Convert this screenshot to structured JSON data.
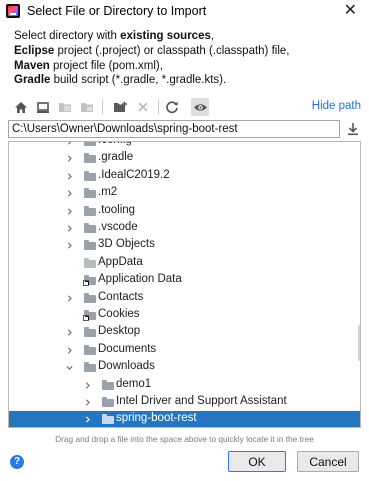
{
  "window": {
    "title": "Select File or Directory to Import",
    "close_symbol": "✕"
  },
  "description": {
    "line1_prefix": "Select directory with ",
    "line1_bold": "existing sources",
    "line1_suffix": ",",
    "line2_bold": "Eclipse",
    "line2_rest": " project (.project) or classpath (.classpath) file,",
    "line3_bold": "Maven",
    "line3_rest": " project file (pom.xml),",
    "line4_bold": "Gradle",
    "line4_rest": " build script (*.gradle, *.gradle.kts)."
  },
  "toolbar": {
    "buttons": [
      "home-icon",
      "desktop-icon",
      "project-folder-icon",
      "module-folder-icon",
      "new-folder-icon",
      "delete-icon",
      "refresh-icon",
      "show-hidden-icon"
    ],
    "hide_path_label": "Hide path"
  },
  "path": {
    "value": "C:\\Users\\Owner\\Downloads\\spring-boot-rest"
  },
  "tree": {
    "items": [
      {
        "label": ".config",
        "depth": 0,
        "chevron": true,
        "icon": "folder"
      },
      {
        "label": ".gradle",
        "depth": 0,
        "chevron": true,
        "icon": "folder"
      },
      {
        "label": ".IdealC2019.2",
        "depth": 0,
        "chevron": true,
        "icon": "folder"
      },
      {
        "label": ".m2",
        "depth": 0,
        "chevron": true,
        "icon": "folder"
      },
      {
        "label": ".tooling",
        "depth": 0,
        "chevron": true,
        "icon": "folder"
      },
      {
        "label": ".vscode",
        "depth": 0,
        "chevron": true,
        "icon": "folder"
      },
      {
        "label": "3D Objects",
        "depth": 0,
        "chevron": true,
        "icon": "folder"
      },
      {
        "label": "AppData",
        "depth": 0,
        "chevron": false,
        "icon": "folder-light"
      },
      {
        "label": "Application Data",
        "depth": 0,
        "chevron": false,
        "icon": "folder-link"
      },
      {
        "label": "Contacts",
        "depth": 0,
        "chevron": true,
        "icon": "folder"
      },
      {
        "label": "Cookies",
        "depth": 0,
        "chevron": false,
        "icon": "folder-link"
      },
      {
        "label": "Desktop",
        "depth": 0,
        "chevron": true,
        "icon": "folder"
      },
      {
        "label": "Documents",
        "depth": 0,
        "chevron": true,
        "icon": "folder"
      },
      {
        "label": "Downloads",
        "depth": 0,
        "chevron": "open",
        "icon": "folder"
      },
      {
        "label": "demo1",
        "depth": 1,
        "chevron": true,
        "icon": "folder"
      },
      {
        "label": "Intel Driver and Support Assistant",
        "depth": 1,
        "chevron": true,
        "icon": "folder"
      },
      {
        "label": "spring-boot-rest",
        "depth": 1,
        "chevron": true,
        "icon": "folder",
        "selected": true
      }
    ]
  },
  "hint_text": "Drag and drop a file into the space above to quickly locate it in the tree",
  "buttons": {
    "help": "?",
    "ok": "OK",
    "cancel": "Cancel"
  },
  "colors": {
    "accent": "#2675bf",
    "link": "#2470d7",
    "folder": "#9aa1a8",
    "help_blue": "#2a7be0"
  }
}
